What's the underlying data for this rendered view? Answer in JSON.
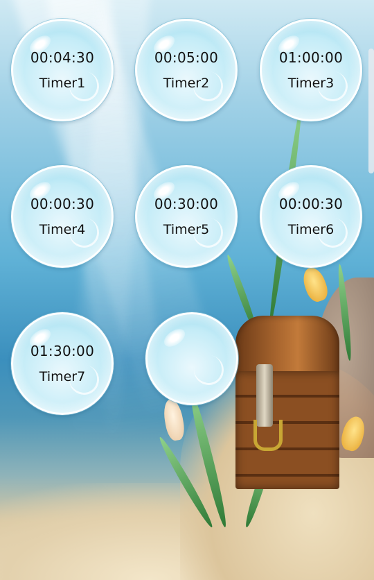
{
  "timers": [
    {
      "time": "00:04:30",
      "label": "Timer1"
    },
    {
      "time": "00:05:00",
      "label": "Timer2"
    },
    {
      "time": "01:00:00",
      "label": "Timer3"
    },
    {
      "time": "00:00:30",
      "label": "Timer4"
    },
    {
      "time": "00:30:00",
      "label": "Timer5"
    },
    {
      "time": "00:00:30",
      "label": "Timer6"
    },
    {
      "time": "01:30:00",
      "label": "Timer7"
    }
  ],
  "add_bubble": {
    "time": "",
    "label": ""
  },
  "colors": {
    "bubble_inner": "#c4ecf7",
    "text": "#111111",
    "water_top": "#cfe9f3",
    "water_deep": "#3b8fbd",
    "sand": "#ead9b8"
  }
}
